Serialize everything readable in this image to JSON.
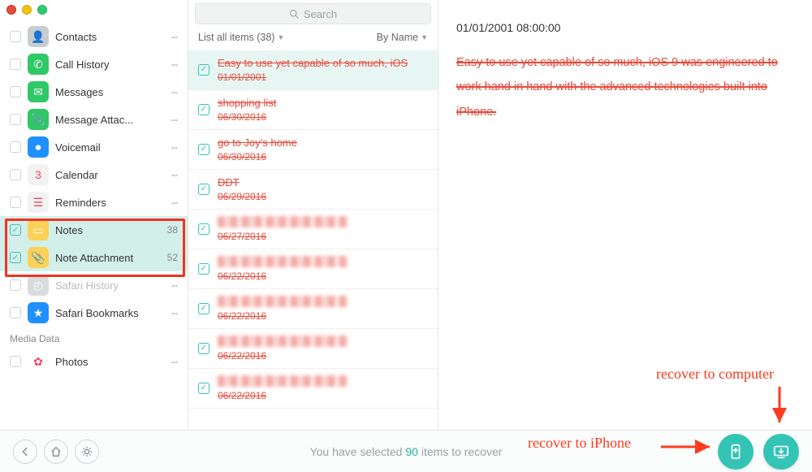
{
  "search": {
    "placeholder": "Search"
  },
  "filter": {
    "list_all_label": "List all items (38)",
    "sort_label": "By Name"
  },
  "categories": [
    {
      "id": "contacts",
      "label": "Contacts",
      "count": "--",
      "selected": false,
      "icon_bg": "#c7ccd1",
      "glyph": "👤"
    },
    {
      "id": "callhistory",
      "label": "Call History",
      "count": "--",
      "selected": false,
      "icon_bg": "#2ec866",
      "glyph": "✆"
    },
    {
      "id": "messages",
      "label": "Messages",
      "count": "--",
      "selected": false,
      "icon_bg": "#2ec866",
      "glyph": "✉︎"
    },
    {
      "id": "msgattach",
      "label": "Message Attac...",
      "count": "--",
      "selected": false,
      "icon_bg": "#2ec866",
      "glyph": "📎"
    },
    {
      "id": "voicemail",
      "label": "Voicemail",
      "count": "--",
      "selected": false,
      "icon_bg": "#1e90ff",
      "glyph": "⏺"
    },
    {
      "id": "calendar",
      "label": "Calendar",
      "count": "--",
      "selected": false,
      "icon_bg": "#f2f2f2",
      "glyph": "3"
    },
    {
      "id": "reminders",
      "label": "Reminders",
      "count": "--",
      "selected": false,
      "icon_bg": "#f2f2f2",
      "glyph": "☰"
    },
    {
      "id": "notes",
      "label": "Notes",
      "count": "38",
      "selected": true,
      "icon_bg": "#fbd157",
      "glyph": "▭"
    },
    {
      "id": "noteattach",
      "label": "Note Attachment",
      "count": "52",
      "selected": true,
      "icon_bg": "#fbd157",
      "glyph": "📎"
    },
    {
      "id": "safariHist",
      "label": "Safari History",
      "count": "--",
      "selected": false,
      "icon_bg": "#d8dcdf",
      "glyph": "◴",
      "dimmed": true
    },
    {
      "id": "safariBm",
      "label": "Safari Bookmarks",
      "count": "--",
      "selected": false,
      "icon_bg": "#1e90ff",
      "glyph": "★"
    }
  ],
  "media_header": "Media Data",
  "media": [
    {
      "id": "photos",
      "label": "Photos",
      "count": "--",
      "selected": false,
      "icon_bg": "#fff",
      "glyph": "✿"
    }
  ],
  "notes_list": [
    {
      "title": "Easy to use yet capable of so much, iOS",
      "date": "01/01/2001",
      "sel": true,
      "blur": false
    },
    {
      "title": "shopping list",
      "date": "06/30/2016",
      "sel": false,
      "blur": false
    },
    {
      "title": "go to Joy's home",
      "date": "06/30/2016",
      "sel": false,
      "blur": false
    },
    {
      "title": "DDT",
      "date": "06/29/2016",
      "sel": false,
      "blur": false
    },
    {
      "title": "",
      "date": "06/27/2016",
      "sel": false,
      "blur": true
    },
    {
      "title": "",
      "date": "06/22/2016",
      "sel": false,
      "blur": true
    },
    {
      "title": "",
      "date": "06/22/2016",
      "sel": false,
      "blur": true
    },
    {
      "title": "",
      "date": "06/22/2016",
      "sel": false,
      "blur": true
    },
    {
      "title": "",
      "date": "06/22/2016",
      "sel": false,
      "blur": true
    }
  ],
  "preview": {
    "timestamp": "01/01/2001 08:00:00",
    "body": "Easy to use yet capable of so much, iOS 9 was engineered to work hand in hand with the advanced technologies built into iPhone."
  },
  "footer": {
    "status_pre": "You have selected ",
    "status_count": "90",
    "status_post": " items to recover"
  },
  "annotations": {
    "to_iphone": "recover to iPhone",
    "to_computer": "recover to computer"
  }
}
